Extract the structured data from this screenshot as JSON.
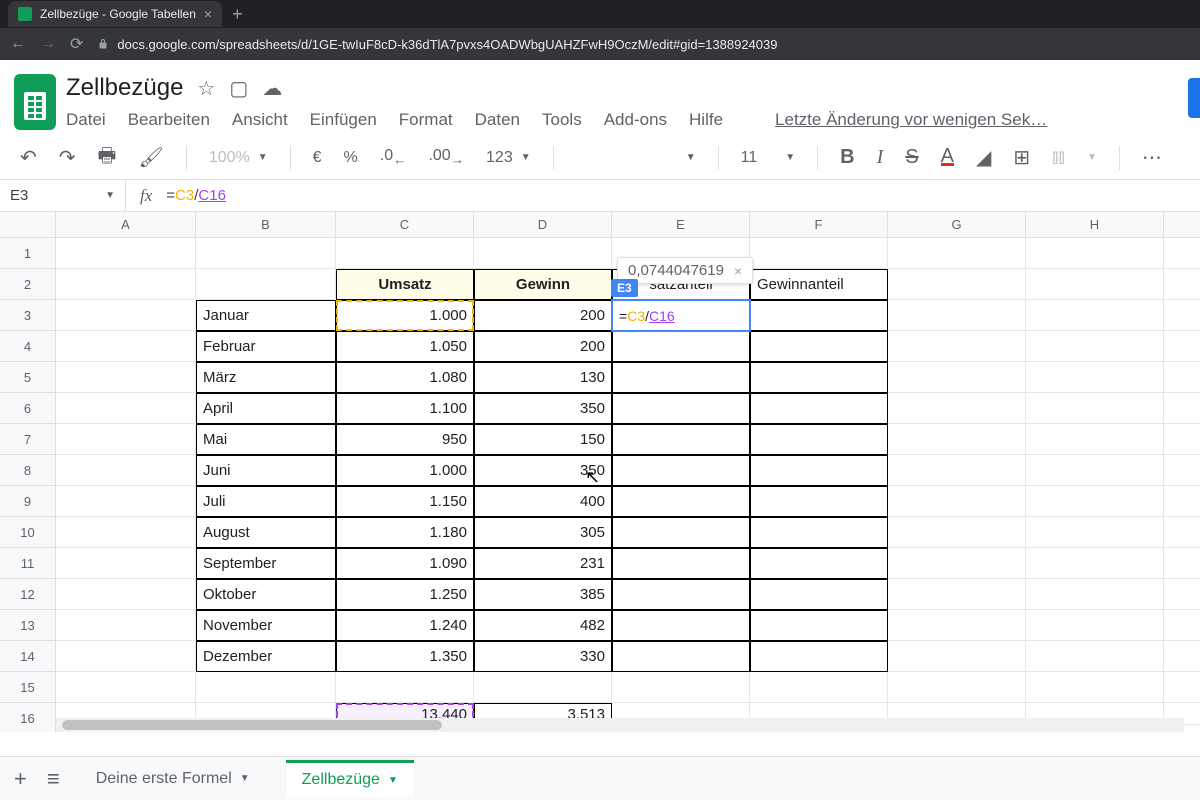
{
  "browser": {
    "tab_title": "Zellbezüge - Google Tabellen",
    "url": "docs.google.com/spreadsheets/d/1GE-twIuF8cD-k36dTlA7pvxs4OADWbgUAHZFwH9OczM/edit#gid=1388924039"
  },
  "doc": {
    "title": "Zellbezüge",
    "menus": [
      "Datei",
      "Bearbeiten",
      "Ansicht",
      "Einfügen",
      "Format",
      "Daten",
      "Tools",
      "Add-ons",
      "Hilfe"
    ],
    "activity": "Letzte Änderung vor wenigen Sek…"
  },
  "toolbar": {
    "zoom": "100%",
    "currency": "€",
    "percent": "%",
    "dec_minus": ".0",
    "dec_plus": ".00",
    "formats": "123",
    "font_size": "11"
  },
  "formula_bar": {
    "cell_ref": "E3",
    "prefix": "=",
    "ref1": "C3",
    "op": "/",
    "ref2": "C16"
  },
  "columns": [
    "A",
    "B",
    "C",
    "D",
    "E",
    "F",
    "G",
    "H"
  ],
  "row_numbers": [
    "1",
    "2",
    "3",
    "4",
    "5",
    "6",
    "7",
    "8",
    "9",
    "10",
    "11",
    "12",
    "13",
    "14",
    "15",
    "16"
  ],
  "headers": {
    "c": "Umsatz",
    "d": "Gewinn",
    "e": "satzanteil",
    "f": "Gewinnanteil"
  },
  "active": {
    "badge": "E3",
    "tooltip_value": "0,0744047619",
    "inline_prefix": "=",
    "inline_ref1": "C3",
    "inline_op": "/",
    "inline_ref2": "C16"
  },
  "rows": [
    {
      "month": "Januar",
      "umsatz": "1.000",
      "gewinn": "200"
    },
    {
      "month": "Februar",
      "umsatz": "1.050",
      "gewinn": "200"
    },
    {
      "month": "März",
      "umsatz": "1.080",
      "gewinn": "130"
    },
    {
      "month": "April",
      "umsatz": "1.100",
      "gewinn": "350"
    },
    {
      "month": "Mai",
      "umsatz": "950",
      "gewinn": "150"
    },
    {
      "month": "Juni",
      "umsatz": "1.000",
      "gewinn": "350"
    },
    {
      "month": "Juli",
      "umsatz": "1.150",
      "gewinn": "400"
    },
    {
      "month": "August",
      "umsatz": "1.180",
      "gewinn": "305"
    },
    {
      "month": "September",
      "umsatz": "1.090",
      "gewinn": "231"
    },
    {
      "month": "Oktober",
      "umsatz": "1.250",
      "gewinn": "385"
    },
    {
      "month": "November",
      "umsatz": "1.240",
      "gewinn": "482"
    },
    {
      "month": "Dezember",
      "umsatz": "1.350",
      "gewinn": "330"
    }
  ],
  "totals": {
    "umsatz": "13.440",
    "gewinn": "3.513"
  },
  "sheets": {
    "tab1": "Deine erste Formel",
    "tab2": "Zellbezüge"
  }
}
